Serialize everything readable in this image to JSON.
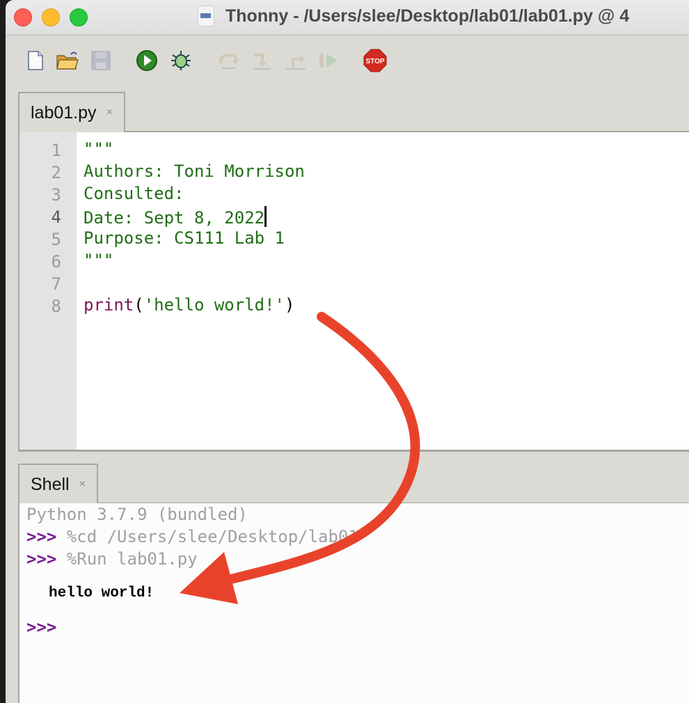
{
  "window": {
    "title": "Thonny  -  /Users/slee/Desktop/lab01/lab01.py  @  4"
  },
  "toolbar": {
    "buttons": [
      {
        "name": "new-file",
        "icon": "new-file-icon",
        "enabled": true
      },
      {
        "name": "open-file",
        "icon": "open-folder-icon",
        "enabled": true
      },
      {
        "name": "save-file",
        "icon": "save-disk-icon",
        "enabled": false
      },
      {
        "name": "run",
        "icon": "run-play-icon",
        "enabled": true
      },
      {
        "name": "debug",
        "icon": "debug-bug-icon",
        "enabled": true
      },
      {
        "name": "step-over",
        "icon": "step-over-icon",
        "enabled": false
      },
      {
        "name": "step-into",
        "icon": "step-into-icon",
        "enabled": false
      },
      {
        "name": "step-out",
        "icon": "step-out-icon",
        "enabled": false
      },
      {
        "name": "resume",
        "icon": "resume-icon",
        "enabled": false
      },
      {
        "name": "stop",
        "icon": "stop-sign-icon",
        "enabled": true,
        "label": "STOP"
      }
    ]
  },
  "editor": {
    "tab_label": "lab01.py",
    "tab_close": "×",
    "line_numbers": [
      "1",
      "2",
      "3",
      "4",
      "5",
      "6",
      "7",
      "8"
    ],
    "lines": {
      "l1": "\"\"\"",
      "l2": "Authors: Toni Morrison",
      "l3": "Consulted:",
      "l4": "Date: Sept 8, 2022",
      "l5": "Purpose: CS111 Lab 1",
      "l6": "\"\"\"",
      "l8_kw": "print",
      "l8_open": "(",
      "l8_str": "'hello world!'",
      "l8_close": ")"
    }
  },
  "shell": {
    "tab_label": "Shell",
    "tab_close": "×",
    "banner": "Python 3.7.9 (bundled)",
    "prompt": ">>>",
    "cmd1": " %cd /Users/slee/Desktop/lab01",
    "cmd2": " %Run lab01.py",
    "output": "hello world!"
  },
  "annotation": {
    "arrow_color": "#e8432a"
  }
}
